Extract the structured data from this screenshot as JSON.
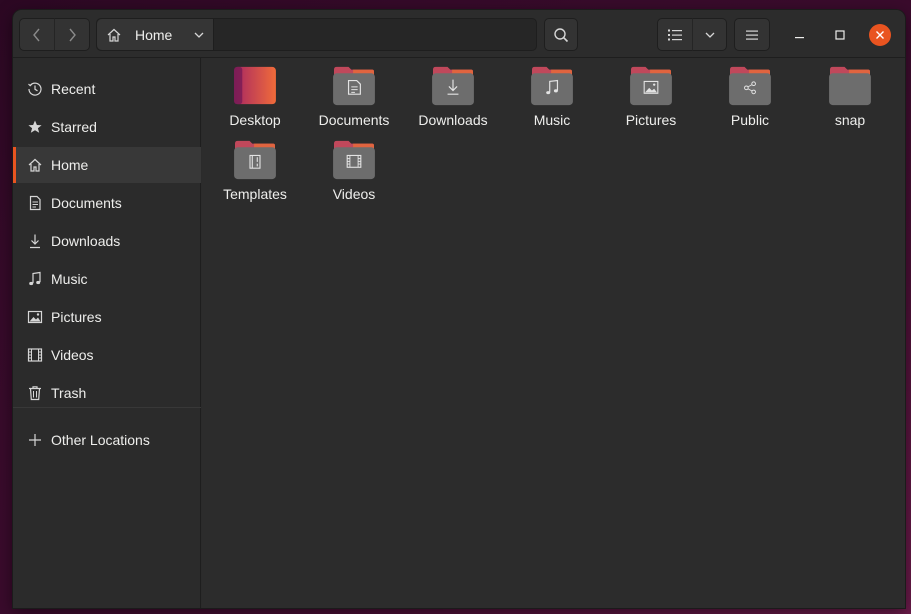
{
  "window": {
    "title": "Home"
  },
  "headerbar": {
    "back_icon": "chevron-left-icon",
    "forward_icon": "chevron-right-icon",
    "path": {
      "label": "Home",
      "icon": "home-icon"
    },
    "search_icon": "search-icon",
    "view_icon": "list-view-icon",
    "menu_icon": "hamburger-menu-icon"
  },
  "sidebar": {
    "items": [
      {
        "label": "Recent",
        "icon": "clock-icon"
      },
      {
        "label": "Starred",
        "icon": "star-icon"
      },
      {
        "label": "Home",
        "icon": "home-icon",
        "active": true
      },
      {
        "label": "Documents",
        "icon": "document-icon"
      },
      {
        "label": "Downloads",
        "icon": "download-icon"
      },
      {
        "label": "Music",
        "icon": "music-note-icon"
      },
      {
        "label": "Pictures",
        "icon": "picture-icon"
      },
      {
        "label": "Videos",
        "icon": "film-icon"
      },
      {
        "label": "Trash",
        "icon": "trash-icon"
      }
    ],
    "other_locations": {
      "label": "Other Locations",
      "icon": "plus-icon"
    }
  },
  "files": [
    {
      "name": "Desktop",
      "icon": "desktop-folder-icon"
    },
    {
      "name": "Documents",
      "icon": "documents-folder-icon"
    },
    {
      "name": "Downloads",
      "icon": "downloads-folder-icon"
    },
    {
      "name": "Music",
      "icon": "music-folder-icon"
    },
    {
      "name": "Pictures",
      "icon": "pictures-folder-icon"
    },
    {
      "name": "Public",
      "icon": "public-folder-icon"
    },
    {
      "name": "snap",
      "icon": "folder-icon"
    },
    {
      "name": "Templates",
      "icon": "templates-folder-icon"
    },
    {
      "name": "Videos",
      "icon": "videos-folder-icon"
    }
  ],
  "colors": {
    "accent": "#e95420",
    "folder_tab": "#c0485b",
    "folder_body": "#6d6d6d"
  }
}
